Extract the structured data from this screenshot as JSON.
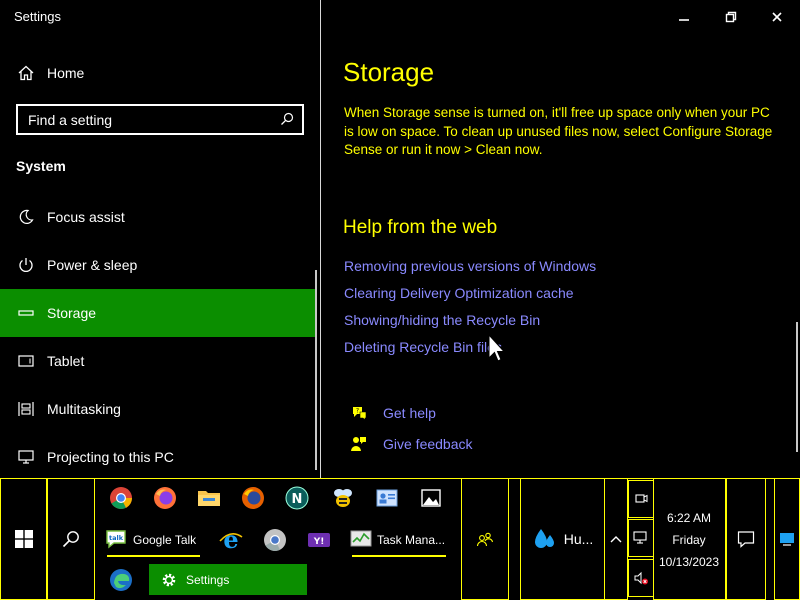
{
  "window": {
    "title": "Settings"
  },
  "sidebar": {
    "home_label": "Home",
    "search_placeholder": "Find a setting",
    "section_label": "System",
    "items": [
      {
        "label": "Focus assist",
        "icon": "moon-icon"
      },
      {
        "label": "Power & sleep",
        "icon": "power-icon"
      },
      {
        "label": "Storage",
        "icon": "storage-icon",
        "selected": true
      },
      {
        "label": "Tablet",
        "icon": "tablet-icon"
      },
      {
        "label": "Multitasking",
        "icon": "multitasking-icon"
      },
      {
        "label": "Projecting to this PC",
        "icon": "projecting-icon"
      }
    ]
  },
  "main": {
    "title": "Storage",
    "description": "When Storage sense is turned on, it'll free up space only when your PC is low on space. To clean up unused files now, select Configure Storage Sense or run it now > Clean now.",
    "help_title": "Help from the web",
    "links": [
      "Removing previous versions of Windows",
      "Clearing Delivery Optimization cache",
      "Showing/hiding the Recycle Bin",
      "Deleting Recycle Bin files"
    ],
    "get_help": "Get help",
    "give_feedback": "Give feedback"
  },
  "taskbar": {
    "apps_row1": [
      "chrome-icon",
      "firefox-icon",
      "file-explorer-icon",
      "firefox-icon",
      "netscape-icon",
      "bee-icon",
      "contacts-icon",
      "photos-icon"
    ],
    "google_talk": "Google Talk",
    "task_manager": "Task Mana...",
    "settings": "Settings",
    "weather": "Hu...",
    "clock_time": "6:22 AM",
    "clock_day": "Friday",
    "clock_date": "10/13/2023"
  },
  "colors": {
    "accent": "#0b8e00",
    "highlight_text": "#ffff00",
    "link": "#8a8aff",
    "background": "#000000"
  }
}
